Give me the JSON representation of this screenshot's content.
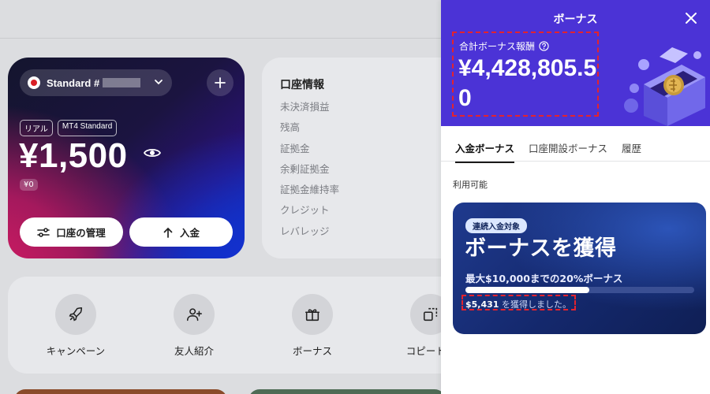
{
  "account_card": {
    "account_label": "Standard #",
    "tags": [
      "リアル",
      "MT4 Standard"
    ],
    "balance": "¥1,500",
    "sub_balance": "¥0",
    "manage_label": "口座の管理",
    "deposit_label": "入金"
  },
  "account_info": {
    "title": "口座情報",
    "items": [
      "未決済損益",
      "残高",
      "証拠金",
      "余剰証拠金",
      "証拠金維持率",
      "クレジット",
      "レバレッジ"
    ]
  },
  "quick_actions": [
    {
      "label": "キャンペーン",
      "icon": "rocket-icon"
    },
    {
      "label": "友人紹介",
      "icon": "add-friend-icon"
    },
    {
      "label": "ボーナス",
      "icon": "gift-icon"
    },
    {
      "label": "コピートレ",
      "icon": "copy-trade-icon"
    }
  ],
  "drawer": {
    "title": "ボーナス",
    "reward_label": "合計ボーナス報酬",
    "reward_amount": "¥4,428,805.50",
    "tabs": [
      {
        "label": "入金ボーナス",
        "active": true
      },
      {
        "label": "口座開設ボーナス",
        "active": false
      },
      {
        "label": "履歴",
        "active": false
      }
    ],
    "section_label": "利用可能",
    "bonus_card": {
      "badge": "連続入金対象",
      "title": "ボーナスを獲得",
      "description": "最大$10,000までの20%ボーナス",
      "progress_fraction": 0.54,
      "earned_amount": "$5,431",
      "earned_suffix": " を獲得しました。"
    }
  },
  "colors": {
    "drawer_header": "#4b33d6",
    "highlight_dashed": "#e3232e",
    "bonus_card": "#14286c"
  }
}
